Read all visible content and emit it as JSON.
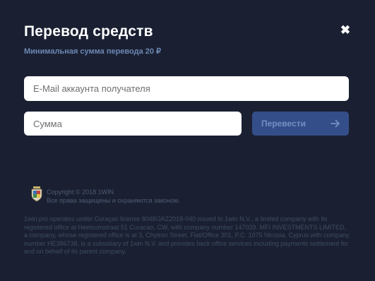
{
  "modal": {
    "title": "Перевод средств",
    "subtitle": "Минимальная сумма перевода 20 ₽",
    "close_icon": "close-icon"
  },
  "form": {
    "email_placeholder": "E-Mail аккаунта получателя",
    "email_value": "",
    "amount_placeholder": "Сумма",
    "amount_value": "",
    "submit_label": "Перевести",
    "submit_icon": "arrow-right-icon"
  },
  "footer": {
    "copyright": "Copyright © 2018 1WIN",
    "rights": "Все права защищены и охраняются законом.",
    "legal": "1win.pro operates under Curaçao license 8048/JAZ2018-040 issued to 1win N.V., a limited company with its registered office at Heelsumstraat 51 Curacao, CW, with company number 147039. MFI INVESTMENTS LIMITED, a company, whose registered office is at 3, Chytron Street, Flat/Office 301, P.C. 1075 Nicosia, Cyprus with company number HE386738, is a subsidiary of 1win N.V. and provides back office services including payments settlement for and on behalf of its parent company.",
    "logo_icon": "license-seal-icon"
  },
  "colors": {
    "background": "#1a2032",
    "accent": "#344e89",
    "subtitle": "#6d87b3"
  }
}
